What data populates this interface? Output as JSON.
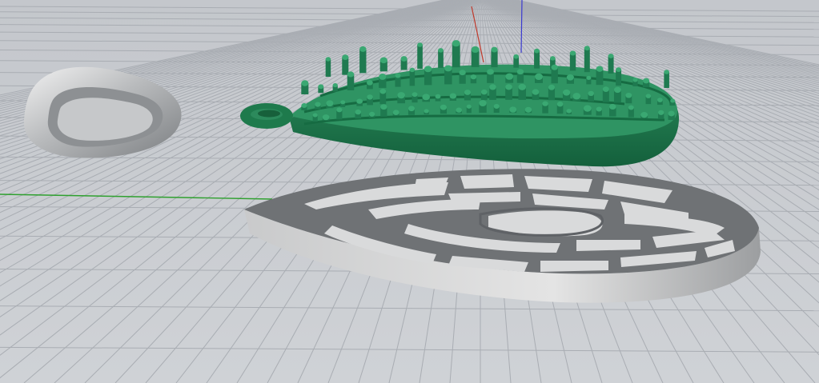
{
  "viewport": {
    "view": "perspective",
    "background_color": "#c9ccd1",
    "grid_color": "#a9adb3",
    "axis_x_color": "#2fa02f",
    "axis_y_color": "#c0392b",
    "axis_z_color": "#3a3ad0"
  },
  "objects": [
    {
      "name": "bail-loop",
      "material_color": "#b5b7b9",
      "shape": "rounded teardrop ring"
    },
    {
      "name": "green-textured-pendant",
      "material_color": "#1f7a50",
      "shape": "teardrop plate with bead rows and loop"
    },
    {
      "name": "silver-openwork-pendant",
      "material_color": "#aeb0b2",
      "shape": "teardrop frame with concentric openwork"
    }
  ]
}
